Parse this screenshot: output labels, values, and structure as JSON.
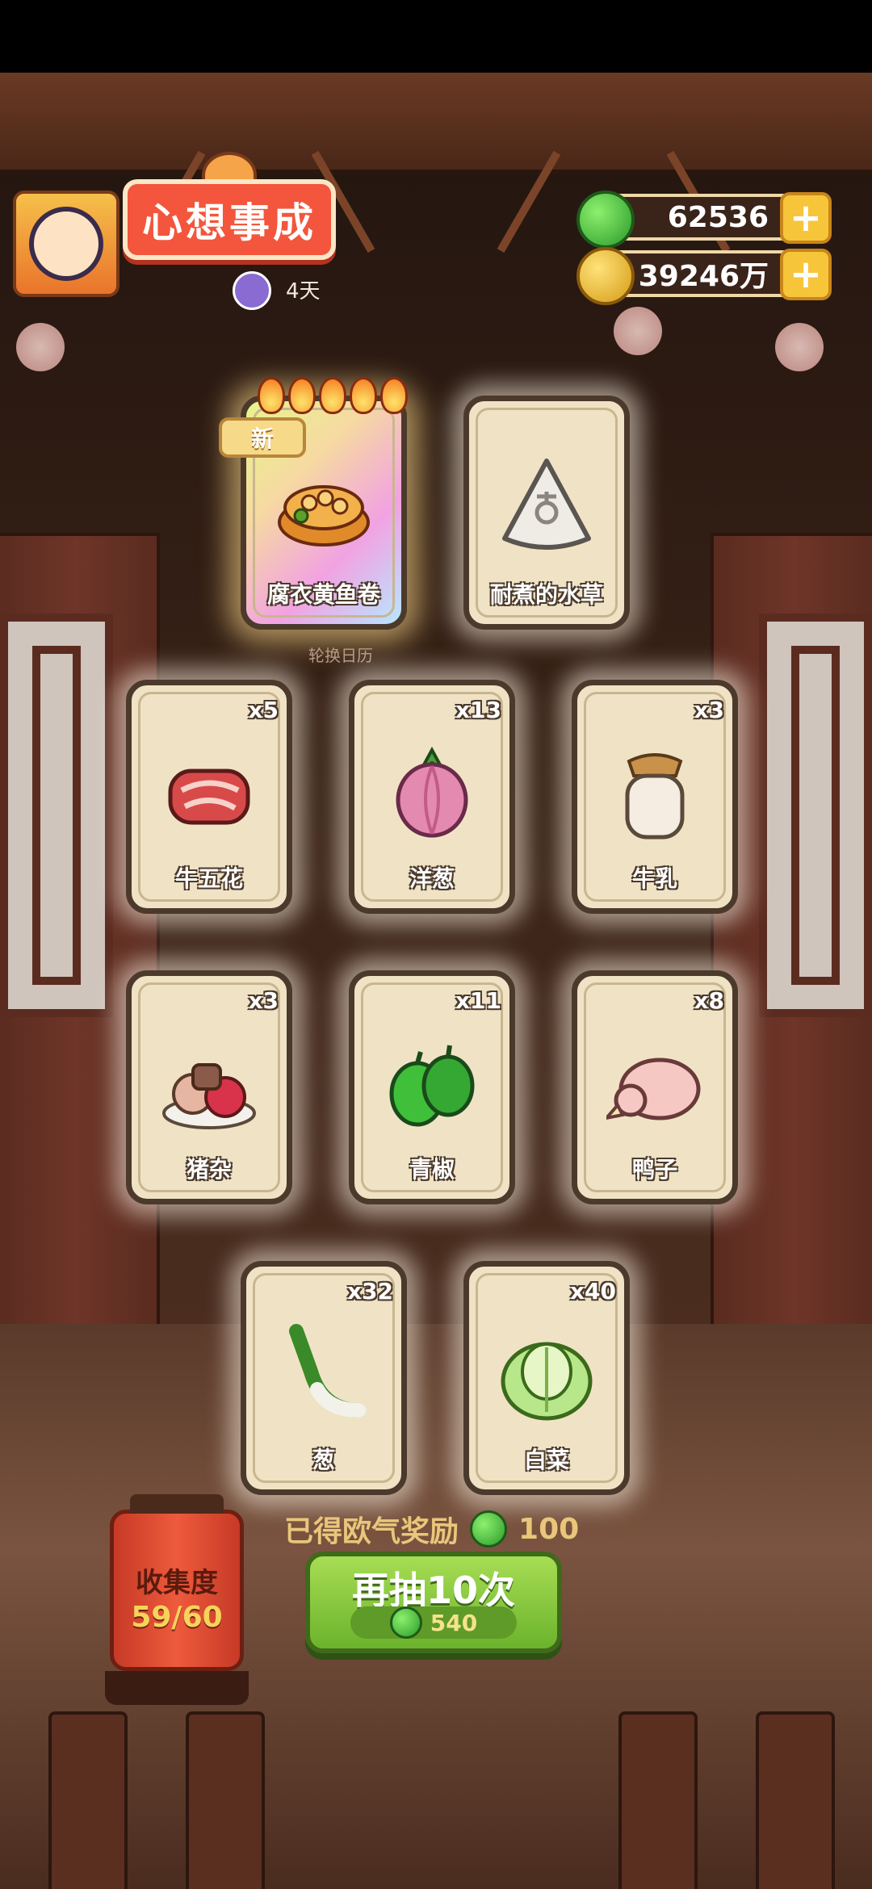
{
  "header": {
    "title": "心想事成",
    "days_left": "4天"
  },
  "currencies": {
    "jade": "62536",
    "coins": "39246万"
  },
  "featured": {
    "caption": "轮换日历",
    "new_badge": "新",
    "cards": [
      {
        "name": "腐衣黄鱼卷",
        "icon": "fish-roll-bowl-icon"
      },
      {
        "name": "耐煮的水草",
        "icon": "locked-seaweed-icon"
      }
    ]
  },
  "cards": [
    {
      "name": "牛五花",
      "count": "x5",
      "icon": "beef-icon"
    },
    {
      "name": "洋葱",
      "count": "x13",
      "icon": "onion-icon"
    },
    {
      "name": "牛乳",
      "count": "x3",
      "icon": "milk-jar-icon"
    },
    {
      "name": "猪杂",
      "count": "x3",
      "icon": "pork-offal-icon"
    },
    {
      "name": "青椒",
      "count": "x11",
      "icon": "green-pepper-icon"
    },
    {
      "name": "鸭子",
      "count": "x8",
      "icon": "duck-icon"
    },
    {
      "name": "葱",
      "count": "x32",
      "icon": "scallion-icon"
    },
    {
      "name": "白菜",
      "count": "x40",
      "icon": "cabbage-icon"
    }
  ],
  "reward": {
    "label": "已得欧气奖励",
    "value": "100"
  },
  "draw_button": {
    "label": "再抽10次",
    "cost": "540"
  },
  "collection": {
    "label": "收集度",
    "progress": "59/60"
  }
}
